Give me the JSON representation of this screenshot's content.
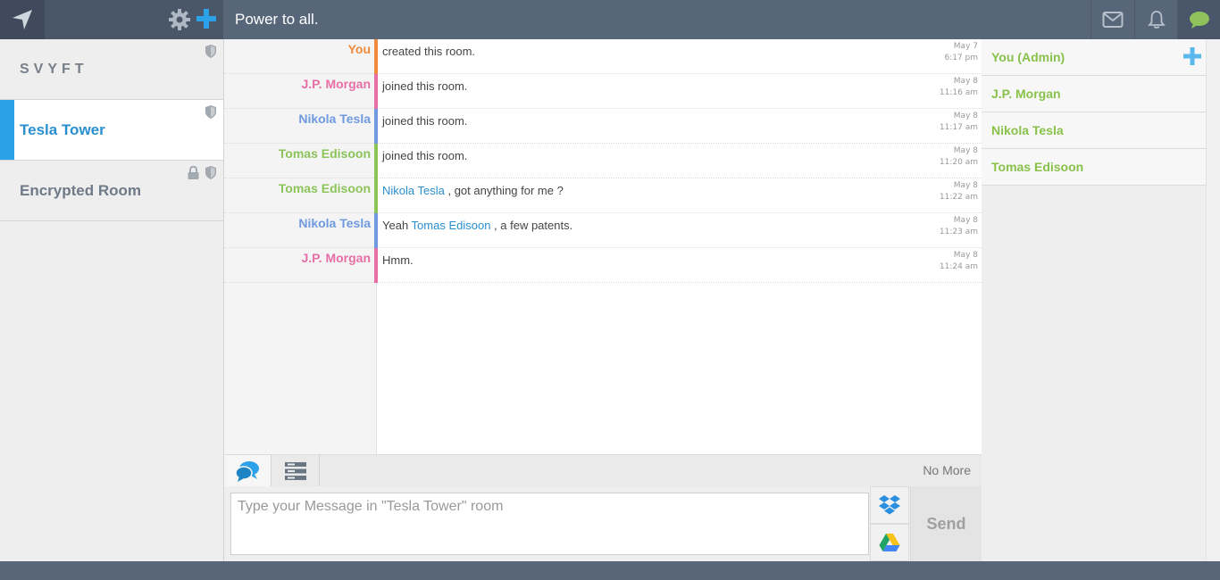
{
  "header": {
    "room_title": "Power to all.",
    "colors": {
      "bar": "#58667a",
      "accent": "#2aa1e8",
      "chat_active": "#8fc25a"
    },
    "icons": [
      "navigation-icon",
      "gear-icon",
      "plus-icon",
      "mail-icon",
      "bell-icon",
      "chat-bubble-icon"
    ]
  },
  "sidebar": {
    "rooms": [
      {
        "name": "SVYFT",
        "active": false,
        "locked": false
      },
      {
        "name": "Tesla Tower",
        "active": true,
        "locked": false
      },
      {
        "name": "Encrypted Room",
        "active": false,
        "locked": true
      }
    ]
  },
  "chat": {
    "messages": [
      {
        "sender": "You",
        "color": "#f08a3c",
        "text": "created this room.",
        "date": "May 7",
        "time": "6:17 pm"
      },
      {
        "sender": "J.P. Morgan",
        "color": "#e86fa6",
        "text": "joined this room.",
        "date": "May 8",
        "time": "11:16 am"
      },
      {
        "sender": "Nikola Tesla",
        "color": "#6f9ae0",
        "text": "joined this room.",
        "date": "May 8",
        "time": "11:17 am"
      },
      {
        "sender": "Tomas Edisoon",
        "color": "#8cc45a",
        "text": "joined this room.",
        "date": "May 8",
        "time": "11:20 am"
      },
      {
        "sender": "Tomas Edisoon",
        "color": "#8cc45a",
        "mention": "Nikola Tesla",
        "text_after": " , got anything for me ?",
        "date": "May 8",
        "time": "11:22 am"
      },
      {
        "sender": "Nikola Tesla",
        "color": "#6f9ae0",
        "text_before": "Yeah ",
        "mention": "Tomas Edisoon",
        "text_after": " , a few patents.",
        "date": "May 8",
        "time": "11:23 am"
      },
      {
        "sender": "J.P. Morgan",
        "color": "#e86fa6",
        "text": "Hmm.",
        "date": "May 8",
        "time": "11:24 am"
      }
    ]
  },
  "tabs": {
    "no_more": "No More",
    "items": [
      "chat-tab",
      "list-tab"
    ]
  },
  "composer": {
    "placeholder": "Type your Message in \"Tesla Tower\" room",
    "value": "",
    "send_label": "Send",
    "cloud_services": [
      "dropbox-icon",
      "google-drive-icon"
    ]
  },
  "members": {
    "items": [
      "You (Admin)",
      "J.P. Morgan",
      "Nikola Tesla",
      "Tomas Edisoon"
    ]
  }
}
